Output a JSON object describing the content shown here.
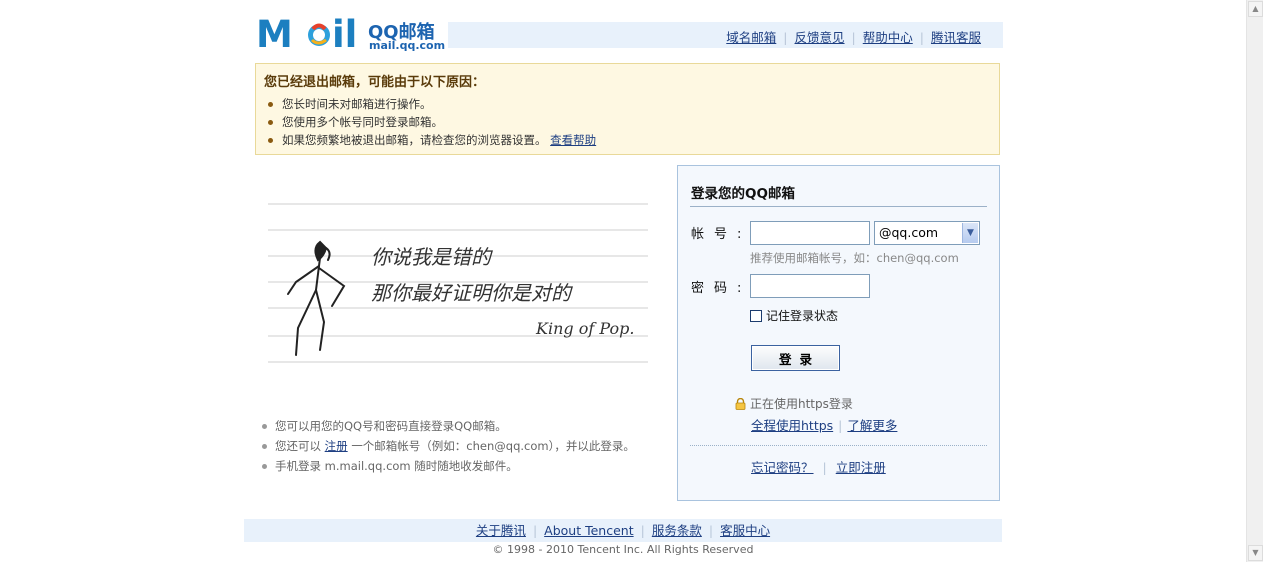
{
  "header": {
    "logo_text": "Mail",
    "logo_cn": "QQ邮箱",
    "logo_url": "mail.qq.com",
    "nav": [
      "域名邮箱",
      "反馈意见",
      "帮助中心",
      "腾讯客服"
    ],
    "separator": "|"
  },
  "notice": {
    "title": "您已经退出邮箱，可能由于以下原因：",
    "items": [
      "您长时间未对邮箱进行操作。",
      "您使用多个帐号同时登录邮箱。",
      "如果您频繁地被退出邮箱，请检查您的浏览器设置。"
    ],
    "help_link": "查看帮助"
  },
  "illustration": {
    "line1": "你说我是错的",
    "line2": "那你最好证明你是对的",
    "signature": "King of Pop."
  },
  "info": {
    "item1": "您可以用您的QQ号和密码直接登录QQ邮箱。",
    "item2_prefix": "您还可以",
    "item2_link": "注册",
    "item2_suffix": "一个邮箱帐号（例如：chen@qq.com），并以此登录。",
    "item3": "手机登录 m.mail.qq.com 随时随地收发邮件。"
  },
  "login": {
    "title": "登录您的QQ邮箱",
    "account_label": "帐号:",
    "account_value": "",
    "domain_selected": "@qq.com",
    "hint": "推荐使用邮箱帐号，如：chen@qq.com",
    "password_label": "密码:",
    "password_value": "",
    "remember_label": "记住登录状态",
    "submit_label": "登录",
    "https_status": "正在使用https登录",
    "https_full": "全程使用https",
    "learn_more": "了解更多",
    "forgot": "忘记密码？",
    "register": "立即注册"
  },
  "footer": {
    "links": [
      "关于腾讯",
      "About Tencent",
      "服务条款",
      "客服中心"
    ],
    "copyright": "© 1998 - 2010 Tencent Inc. All Rights Reserved"
  },
  "colors": {
    "link": "#1e3f82",
    "logo_blue": "#1c7fc0",
    "notice_bg": "#fef8e2",
    "login_bg": "#f4f8fd",
    "bar_bg": "#e8f1fb"
  }
}
